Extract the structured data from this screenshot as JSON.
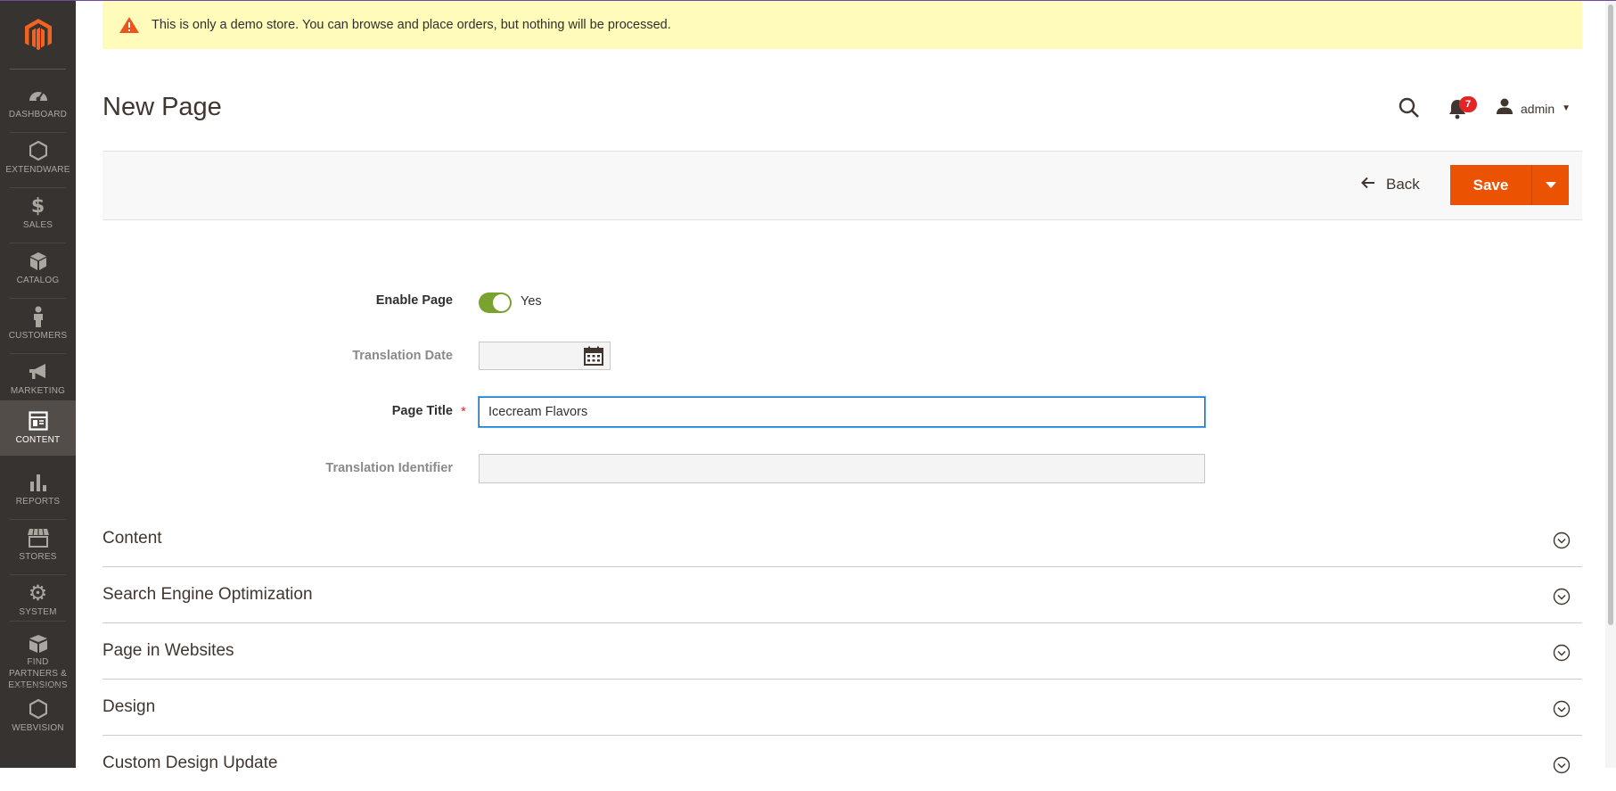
{
  "sidebar": {
    "logo": "magento-logo",
    "items": [
      {
        "label": "DASHBOARD",
        "icon": "dashboard-icon"
      },
      {
        "label": "EXTENDWARE",
        "icon": "hexagon-icon"
      },
      {
        "label": "SALES",
        "icon": "dollar-icon"
      },
      {
        "label": "CATALOG",
        "icon": "cube-icon"
      },
      {
        "label": "CUSTOMERS",
        "icon": "person-icon"
      },
      {
        "label": "MARKETING",
        "icon": "megaphone-icon"
      },
      {
        "label": "CONTENT",
        "icon": "layout-icon",
        "active": true
      },
      {
        "label": "REPORTS",
        "icon": "bar-chart-icon"
      },
      {
        "label": "STORES",
        "icon": "store-icon"
      },
      {
        "label": "SYSTEM",
        "icon": "gear-icon"
      },
      {
        "label": "FIND PARTNERS & EXTENSIONS",
        "icon": "boxes-icon"
      },
      {
        "label": "WEBVISION",
        "icon": "hexagon-icon"
      }
    ]
  },
  "banner": {
    "message": "This is only a demo store. You can browse and place orders, but nothing will be processed.",
    "icon": "warning-icon"
  },
  "header": {
    "title": "New Page",
    "notifications_count": "7",
    "user": "admin"
  },
  "actions": {
    "back_label": "Back",
    "save_label": "Save"
  },
  "form": {
    "enable_page": {
      "label": "Enable Page",
      "value": "Yes",
      "on": true
    },
    "translation_date": {
      "label": "Translation Date",
      "value": ""
    },
    "page_title": {
      "label": "Page Title",
      "required": "*",
      "value": "Icecream Flavors"
    },
    "translation_identifier": {
      "label": "Translation Identifier",
      "value": ""
    }
  },
  "sections": [
    {
      "title": "Content"
    },
    {
      "title": "Search Engine Optimization"
    },
    {
      "title": "Page in Websites"
    },
    {
      "title": "Design"
    },
    {
      "title": "Custom Design Update"
    }
  ],
  "colors": {
    "sidebar_bg": "#373330",
    "sidebar_active": "#524d49",
    "accent": "#eb5202",
    "banner_bg": "#fffbbb",
    "toggle_on": "#79a22e",
    "badge": "#e22626"
  }
}
